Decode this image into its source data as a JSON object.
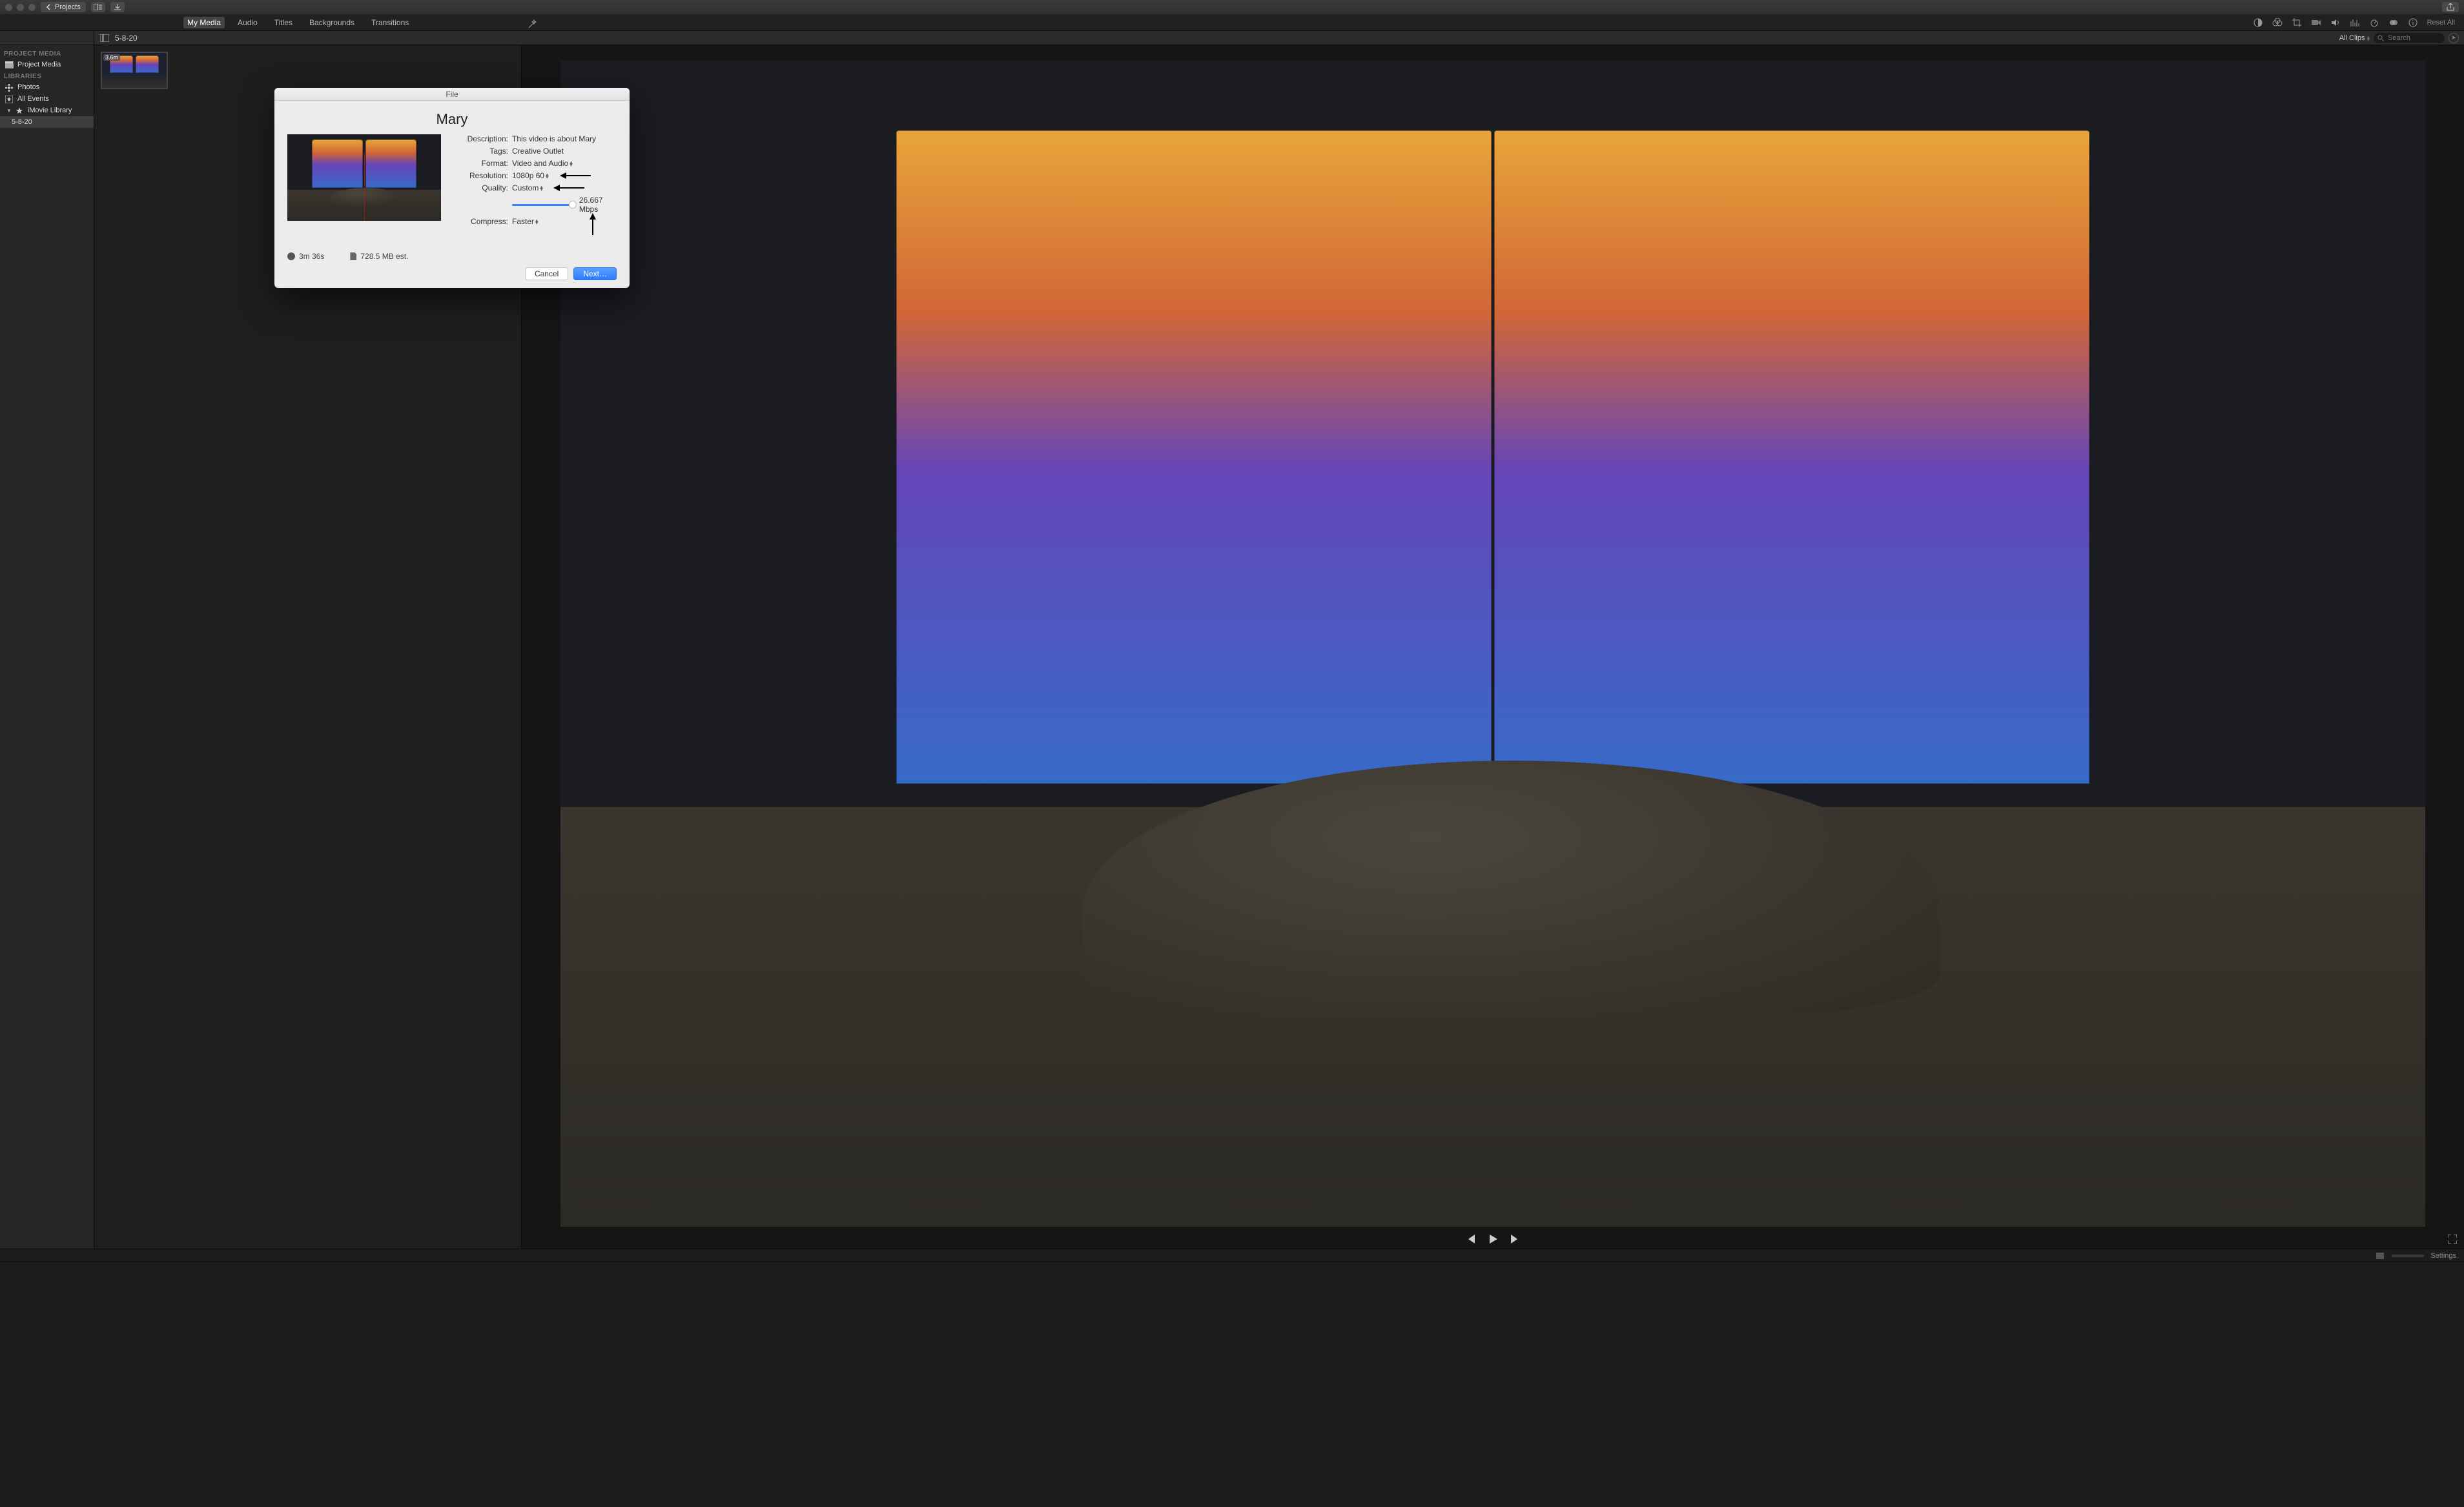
{
  "titlebar": {
    "back_label": "Projects"
  },
  "toolbar": {
    "reset_label": "Reset All"
  },
  "tabs": {
    "my_media": "My Media",
    "audio": "Audio",
    "titles": "Titles",
    "backgrounds": "Backgrounds",
    "transitions": "Transitions"
  },
  "filterbar": {
    "event_name": "5-8-20",
    "clips_filter": "All Clips",
    "search_placeholder": "Search"
  },
  "sidebar": {
    "head_project": "PROJECT MEDIA",
    "project_media": "Project Media",
    "head_libraries": "LIBRARIES",
    "photos": "Photos",
    "all_events": "All Events",
    "imovie_library": "iMovie Library",
    "event_item": "5-8-20"
  },
  "clip": {
    "duration_badge": "3.6m"
  },
  "timeline": {
    "settings_label": "Settings"
  },
  "dialog": {
    "titlebar": "File",
    "project_title": "Mary",
    "labels": {
      "description": "Description:",
      "tags": "Tags:",
      "format": "Format:",
      "resolution": "Resolution:",
      "quality": "Quality:",
      "compress": "Compress:"
    },
    "values": {
      "description": "This video is about Mary",
      "tags": "Creative Outlet",
      "format": "Video and Audio",
      "resolution": "1080p 60",
      "quality": "Custom",
      "bitrate": "26.667 Mbps",
      "compress": "Faster"
    },
    "meta": {
      "duration": "3m 36s",
      "filesize": "728.5 MB est."
    },
    "buttons": {
      "cancel": "Cancel",
      "next": "Next…"
    }
  }
}
